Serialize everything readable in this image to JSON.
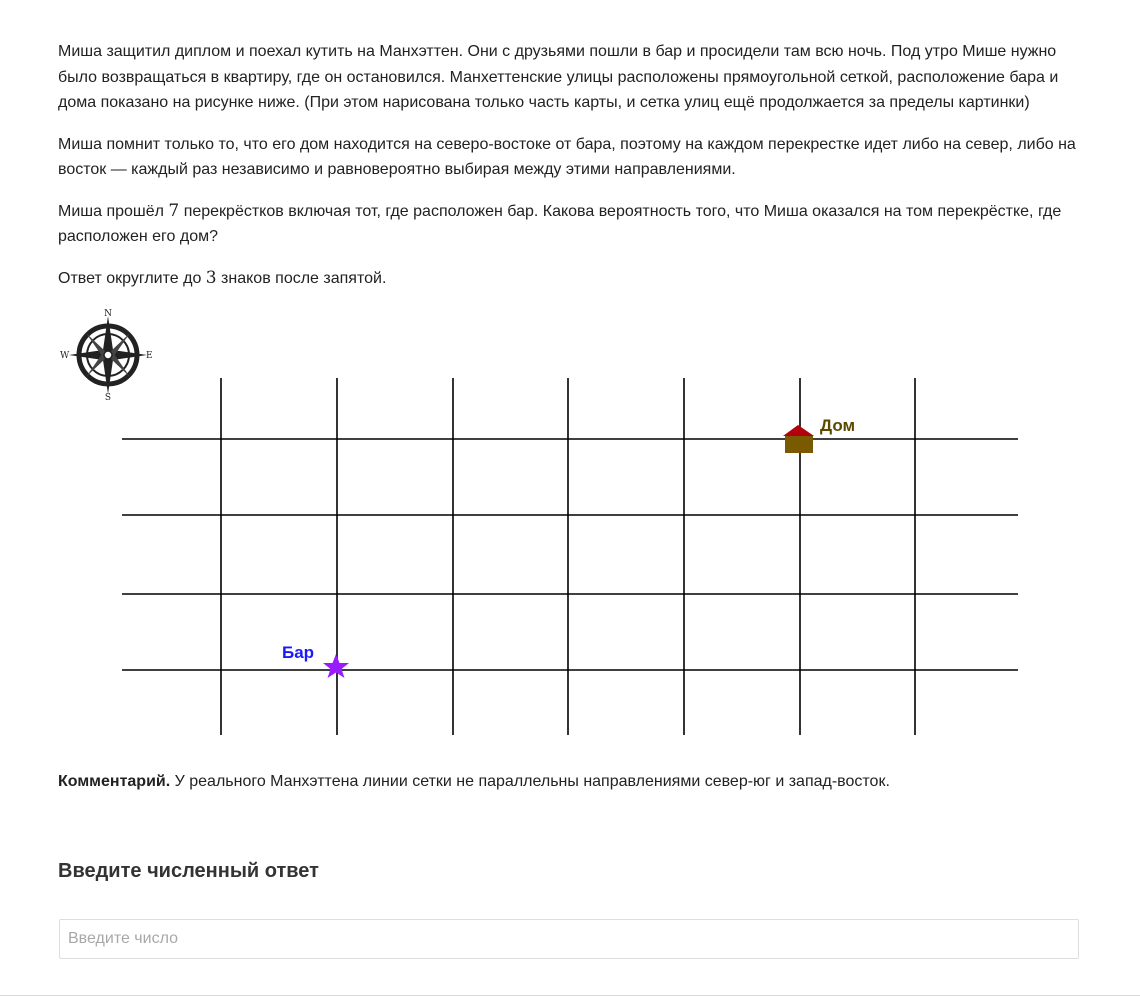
{
  "problem": {
    "p1": "Миша защитил диплом и поехал кутить на Манхэттен. Они с друзьями пошли в бар и просидели там всю ночь. Под утро Мише нужно было возвращаться в квартиру, где он остановился. Манхеттенские улицы расположены прямоугольной сеткой, расположение бара и дома показано на рисунке ниже. (При этом нарисована только часть карты, и сетка улиц ещё продолжается за пределы картинки)",
    "p2": "Миша помнит только то, что его дом находится на северо-востоке от бара, поэтому на каждом перекрестке идет либо на север, либо на восток — каждый раз независимо и равновероятно выбирая между этими направлениями.",
    "p3_a": "Миша прошёл ",
    "p3_num": "7",
    "p3_b": " перекрёстков включая тот, где расположен бар. Какова вероятность того, что Миша оказался на том перекрёстке, где расположен его дом?",
    "p4_a": "Ответ округлите до ",
    "p4_num": "3",
    "p4_b": " знаков после запятой."
  },
  "map": {
    "compass": {
      "n": "N",
      "s": "S",
      "w": "W",
      "e": "E"
    },
    "home_label": "Дом",
    "bar_label": "Бар",
    "colors": {
      "grid": "#000000",
      "home_label": "#5c4a00",
      "bar_label": "#1a1aff",
      "roof": "#b3000f",
      "house_body": "#7a5a00",
      "star": "#9b1bff"
    }
  },
  "comment": {
    "bold": "Комментарий.",
    "text": " У реального Манхэттена линии сетки не параллельны направлениями север-юг и запад-восток."
  },
  "answer": {
    "title": "Введите численный ответ",
    "placeholder": "Введите число",
    "value": ""
  }
}
